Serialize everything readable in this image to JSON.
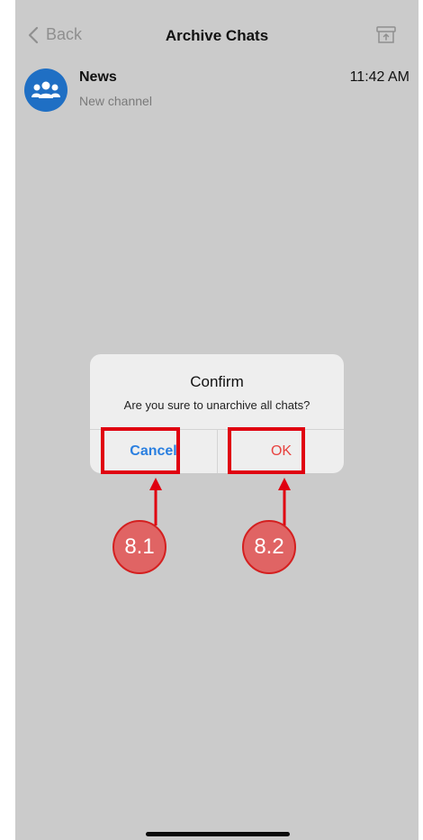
{
  "nav": {
    "back_label": "Back",
    "title": "Archive Chats",
    "archive_icon": "unarchive-box-icon"
  },
  "chats": [
    {
      "name": "News",
      "subtitle": "New channel",
      "time": "11:42 AM",
      "avatar_icon": "group-icon",
      "avatar_color": "#1f6fc4"
    }
  ],
  "dialog": {
    "title": "Confirm",
    "message": "Are you sure to unarchive all chats?",
    "cancel_label": "Cancel",
    "ok_label": "OK",
    "cancel_color": "#2a7fe0",
    "ok_color": "#e8423f"
  },
  "annotations": {
    "step_cancel": "8.1",
    "step_ok": "8.2",
    "color": "#e00010"
  }
}
